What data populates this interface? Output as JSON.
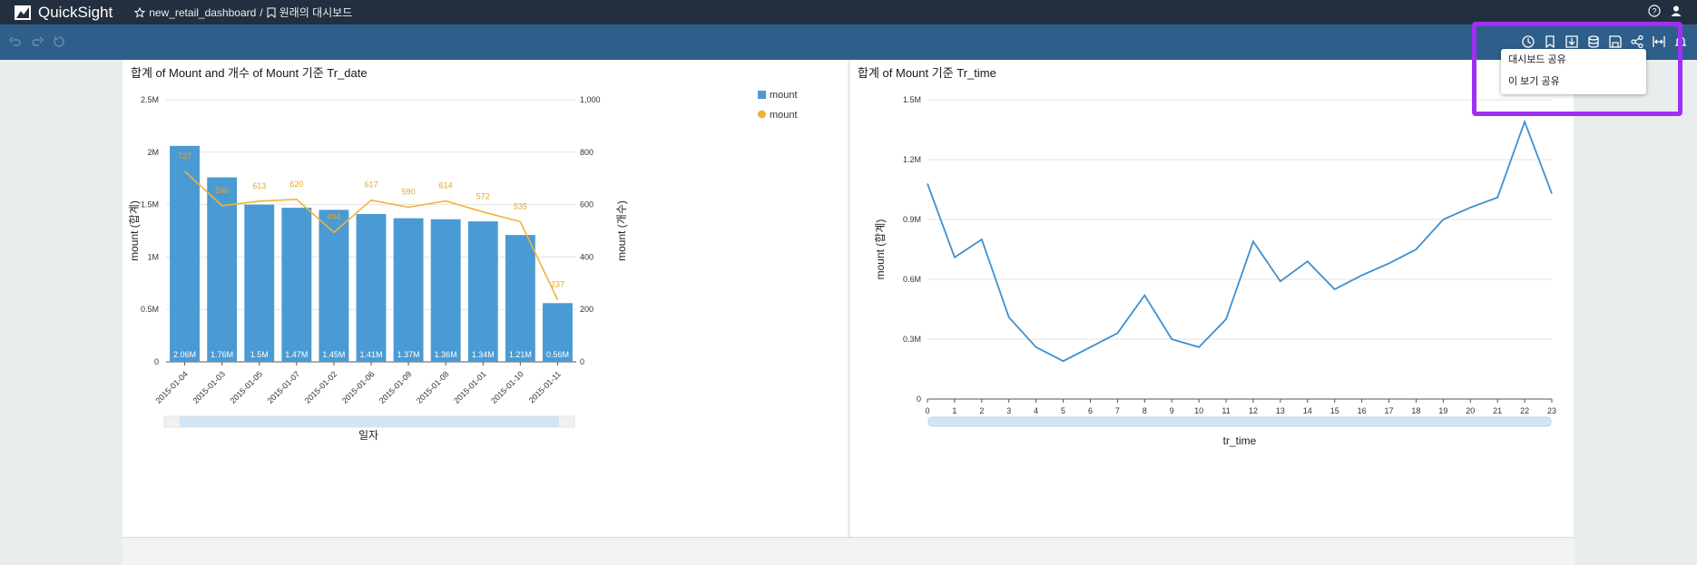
{
  "app": {
    "name": "QuickSight",
    "breadcrumb_dashboard": "new_retail_dashboard",
    "breadcrumb_sep": "/",
    "breadcrumb_view": "원래의 대시보드"
  },
  "share_menu": {
    "items": [
      "대시보드 공유",
      "이 보기 공유"
    ]
  },
  "colors": {
    "bar": "#4a9ad4",
    "line": "#f2b23a",
    "line2": "#3d8fcf",
    "topbar": "#232f3e",
    "toolbar": "#2e5f8a",
    "highlight": "#a02ff5"
  },
  "chart1": {
    "title": "합계 of Mount and 개수 of Mount 기준 Tr_date",
    "legend": [
      "mount",
      "mount"
    ],
    "scroll_label": "일자"
  },
  "chart2": {
    "title": "합계 of Mount 기준 Tr_time"
  },
  "chart_data": [
    {
      "type": "bar",
      "title": "합계 of Mount and 개수 of Mount 기준 Tr_date",
      "xlabel": "일자",
      "ylabel": "mount (합계)",
      "y2label": "mount (개수)",
      "categories": [
        "2015-01-04",
        "2015-01-03",
        "2015-01-05",
        "2015-01-07",
        "2015-01-02",
        "2015-01-06",
        "2015-01-09",
        "2015-01-08",
        "2015-01-01",
        "2015-01-10",
        "2015-01-11"
      ],
      "series": [
        {
          "name": "mount",
          "type": "bar",
          "axis": "left",
          "values": [
            2.06,
            1.76,
            1.5,
            1.47,
            1.45,
            1.41,
            1.37,
            1.36,
            1.34,
            1.21,
            0.56
          ],
          "labels": [
            "2.06M",
            "1.76M",
            "1.5M",
            "1.47M",
            "1.45M",
            "1.41M",
            "1.37M",
            "1.36M",
            "1.34M",
            "1.21M",
            "0.56M"
          ]
        },
        {
          "name": "mount",
          "type": "line",
          "axis": "right",
          "values": [
            727,
            596,
            613,
            620,
            494,
            617,
            590,
            614,
            572,
            535,
            237
          ]
        }
      ],
      "ylim": [
        0,
        2.5
      ],
      "yticks": [
        "0",
        "0.5M",
        "1M",
        "1.5M",
        "2M",
        "2.5M"
      ],
      "y2lim": [
        0,
        1000
      ],
      "y2ticks": [
        "0",
        "200",
        "400",
        "600",
        "800",
        "1,000"
      ],
      "legend_position": "top-right",
      "grid": true
    },
    {
      "type": "line",
      "title": "합계 of Mount 기준 Tr_time",
      "xlabel": "tr_time",
      "ylabel": "mount (합계)",
      "x": [
        0,
        1,
        2,
        3,
        4,
        5,
        6,
        7,
        8,
        9,
        10,
        11,
        12,
        13,
        14,
        15,
        16,
        17,
        18,
        19,
        20,
        21,
        22,
        23
      ],
      "values": [
        1.08,
        0.71,
        0.8,
        0.41,
        0.26,
        0.19,
        0.26,
        0.33,
        0.52,
        0.3,
        0.26,
        0.4,
        0.79,
        0.59,
        0.69,
        0.55,
        0.62,
        0.68,
        0.75,
        0.9,
        0.96,
        1.01,
        1.39,
        1.03
      ],
      "ylim": [
        0,
        1.5
      ],
      "yticks": [
        "0",
        "0.3M",
        "0.6M",
        "0.9M",
        "1.2M",
        "1.5M"
      ],
      "grid": true
    }
  ]
}
